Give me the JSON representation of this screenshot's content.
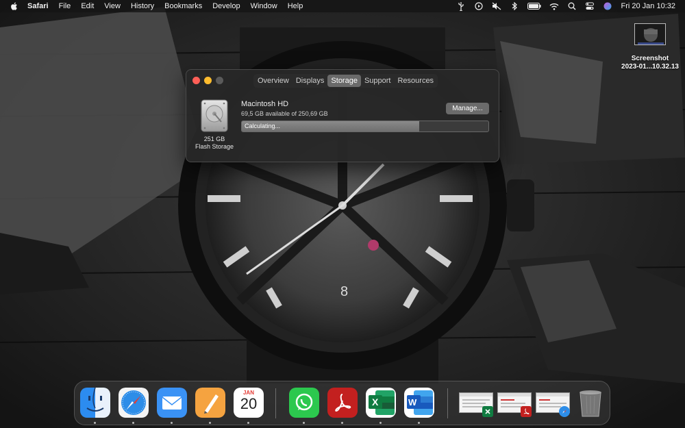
{
  "menubar": {
    "items": [
      "Safari",
      "File",
      "Edit",
      "View",
      "History",
      "Bookmarks",
      "Develop",
      "Window",
      "Help"
    ],
    "clock": "Fri 20 Jan  10:32",
    "status_icons": [
      "usb-icon",
      "play-circle-icon",
      "mute-icon",
      "bluetooth-icon",
      "battery-icon",
      "wifi-icon",
      "search-icon",
      "control-center-icon",
      "siri-icon"
    ]
  },
  "desktop": {
    "file_name_line1": "Screenshot",
    "file_name_line2": "2023-01...10.32.13"
  },
  "about_window": {
    "tabs": [
      "Overview",
      "Displays",
      "Storage",
      "Support",
      "Resources"
    ],
    "active_tab": "Storage",
    "drive_size": "251 GB",
    "drive_type": "Flash Storage",
    "disk_name": "Macintosh HD",
    "available": "69,5 GB available of 250,69 GB",
    "manage_label": "Manage...",
    "progress_label": "Calculating...",
    "progress_fraction": 0.72
  },
  "dock": {
    "calendar_month": "JAN",
    "calendar_day": "20",
    "apps": [
      "finder-icon",
      "safari-icon",
      "mail-icon",
      "pages-icon",
      "calendar-icon",
      "whatsapp-icon",
      "acrobat-icon",
      "excel-icon",
      "word-icon"
    ],
    "recent_documents": [
      "excel-document-thumbnail",
      "pdf-document-thumbnail",
      "safari-page-thumbnail"
    ],
    "trash": "trash-icon"
  },
  "colors": {
    "close": "#ff5f57",
    "minimize": "#febc2e",
    "active_tab": "#6a6a6a",
    "progress_fill": "#7c7c7c"
  }
}
